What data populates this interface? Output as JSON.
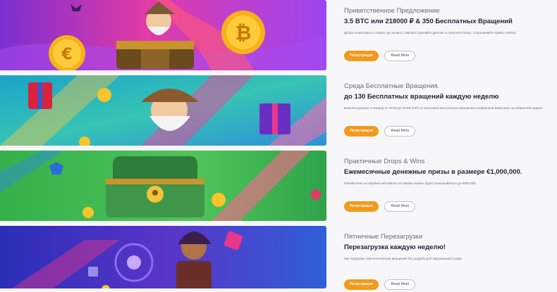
{
  "colors": {
    "accent": "#f29a1c",
    "title": "#23233a",
    "subtitle": "#6b6b78",
    "background": "#f7f7f9"
  },
  "promotions": [
    {
      "subtitle": "Приветственное Предложение",
      "title": "3.5 BTC или 218000 ₽ & 350 Бесплатных Вращений",
      "description": "Добро пожаловать в новую эру казино с Bitcoin! Сделайте депозит и получите бонус. Спрашивайте прямо сейчас!",
      "register_label": "Регистрация",
      "more_label": "Read More",
      "banner_icon": "gnome-with-treasure-chest-and-coins"
    },
    {
      "subtitle": "Среда Бесплатные Вращения.",
      "title": "до 130 Бесплатных вращений каждую неделю",
      "description": "Внесите депозит и период от 00:00 до 23:59 (CET) и получайте Бесплатные вращения в избранной вами игре на избранной неделе",
      "register_label": "Регистрация",
      "more_label": "Read More",
      "banner_icon": "bearded-miner-with-gift-boxes"
    },
    {
      "subtitle": "Практичные Drops & Wins",
      "title": "Ежемесячные денежные призы в размере €1,000,000.",
      "description": "Ежемесячно на игровых автоматах и в живом казино будет разыгрываться до €500,000.",
      "register_label": "Регистрация",
      "more_label": "Read More",
      "banner_icon": "green-treasure-chest"
    },
    {
      "subtitle": "Пятничные Перезагрузки",
      "title": "Перезагрузка каждую неделю!",
      "description": "Мы подаришь вам Бесплатные вращения без ущерба для окружающей среды.",
      "register_label": "Регистрация",
      "more_label": "Read More",
      "banner_icon": "sorceress-with-magic-orb"
    }
  ]
}
